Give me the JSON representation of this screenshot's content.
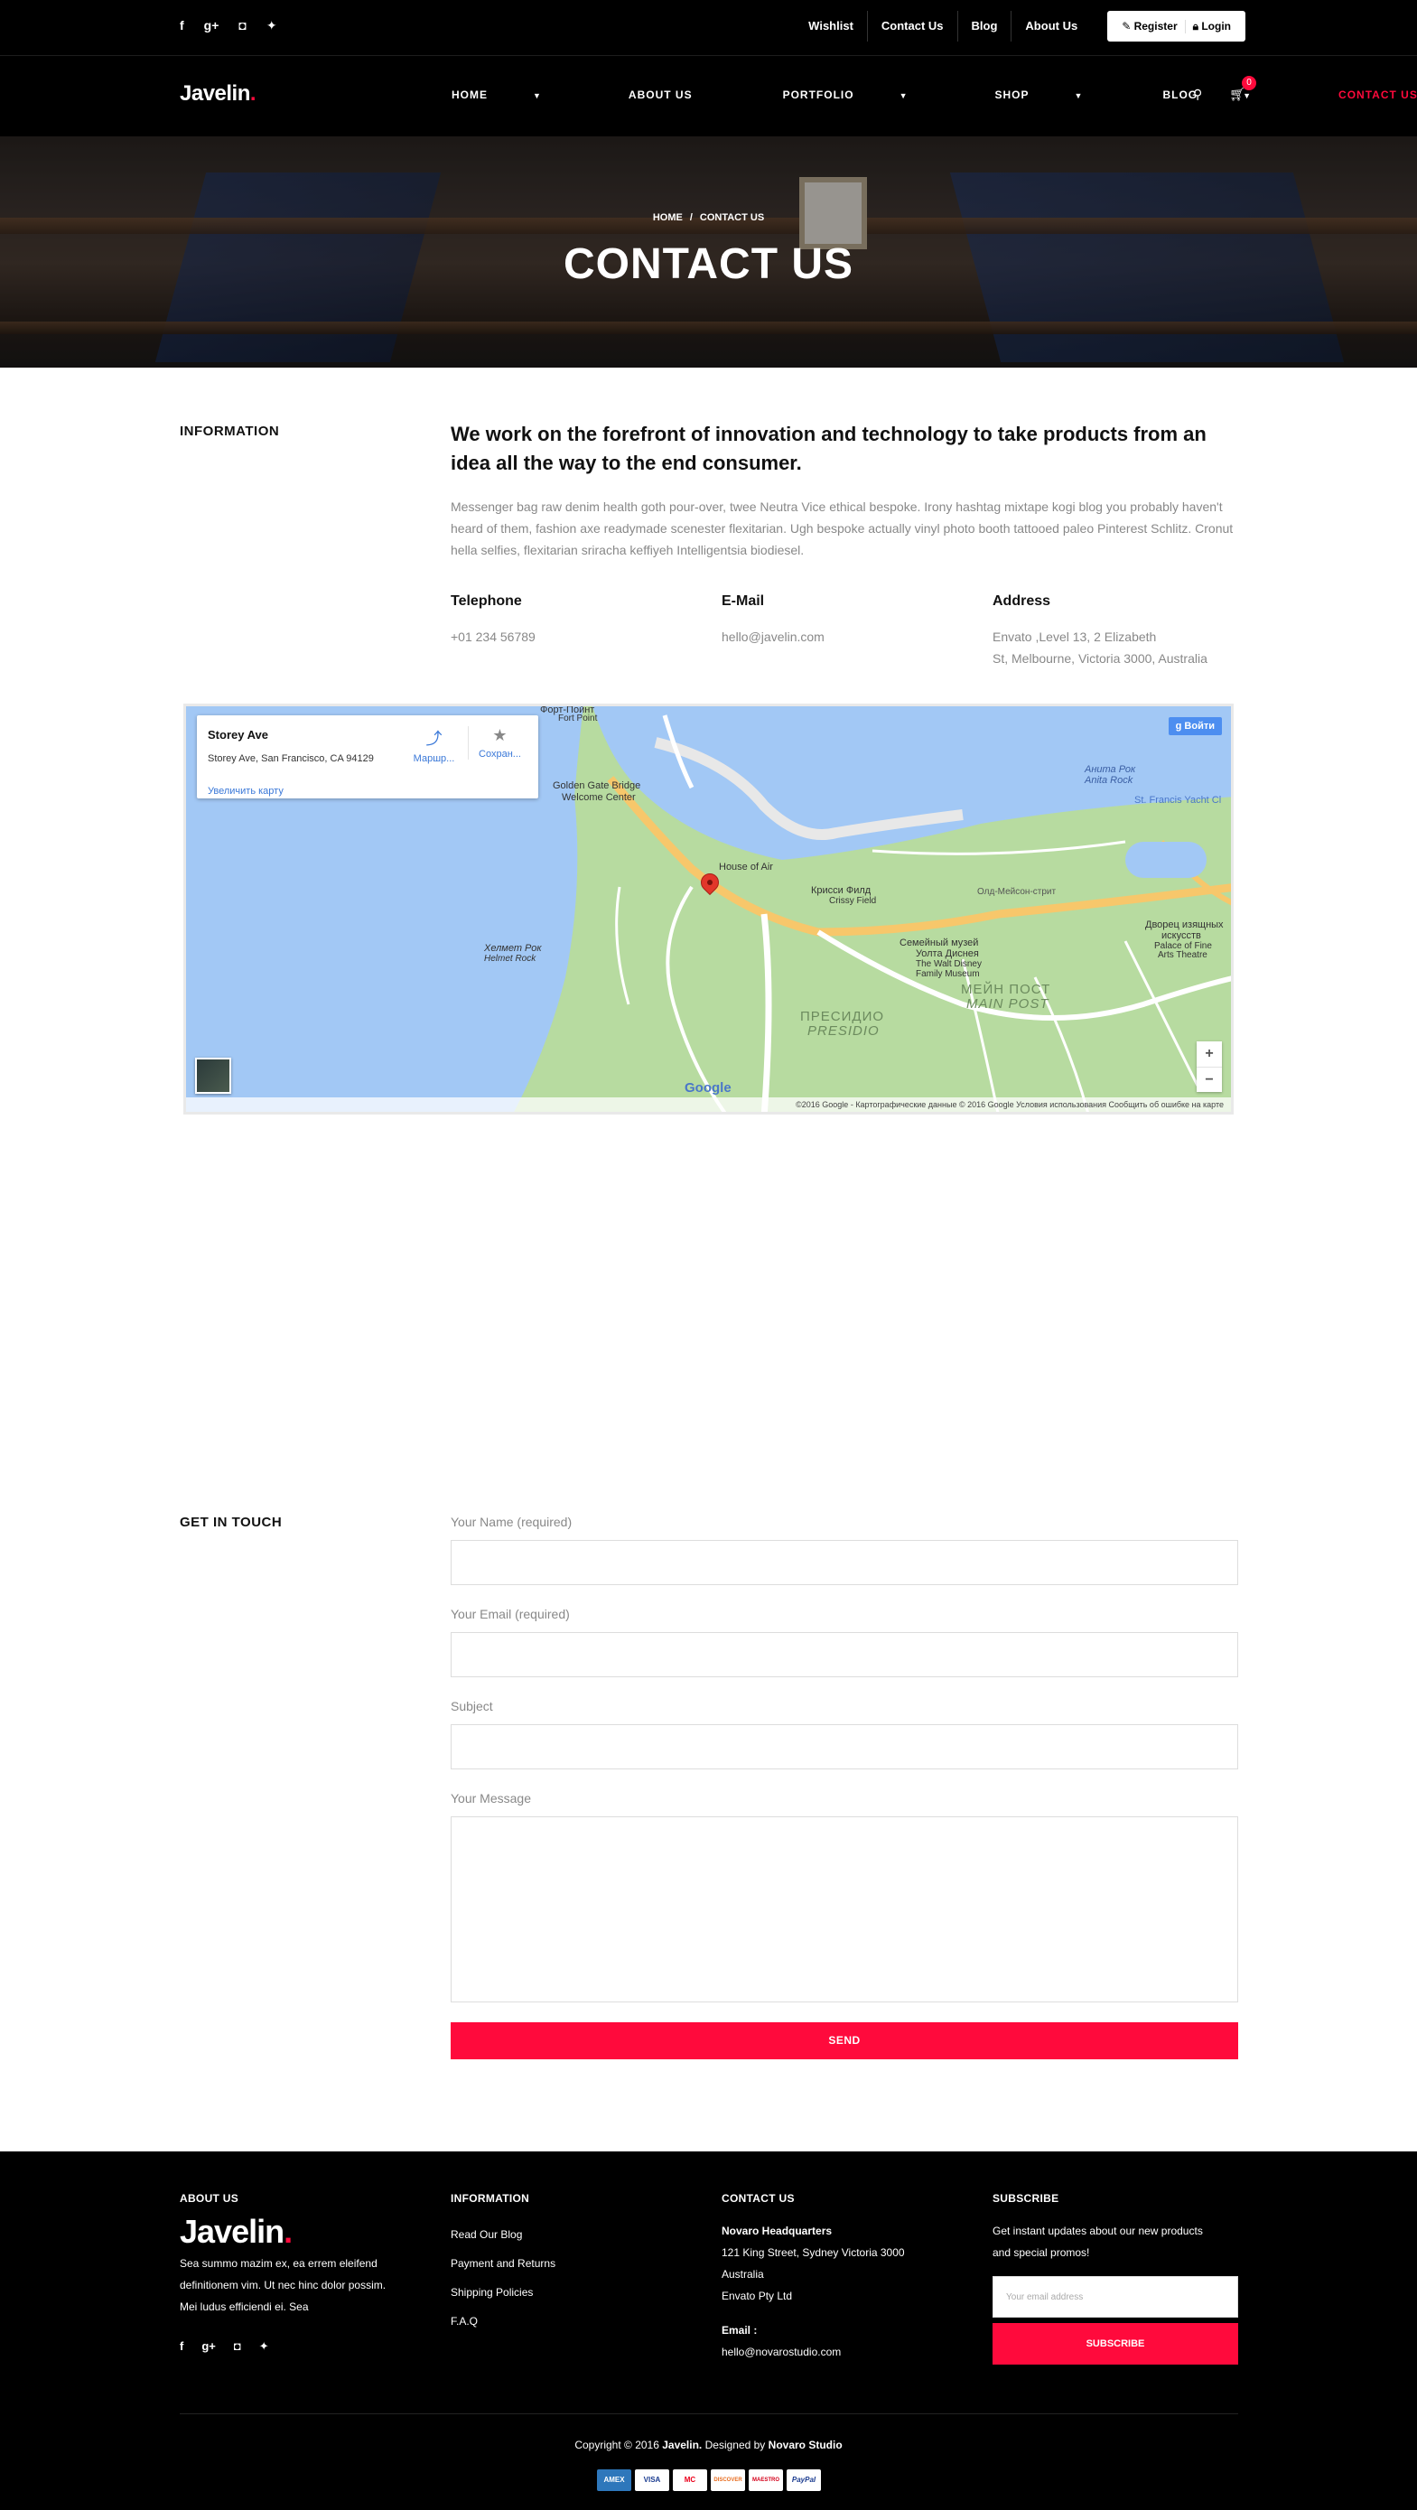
{
  "topbar": {
    "social_icons": [
      "facebook-icon",
      "google-plus-icon",
      "instagram-icon",
      "twitter-icon"
    ],
    "links": [
      "Wishlist",
      "Contact Us",
      "Blog",
      "About Us"
    ],
    "register": "Register",
    "login": "Login"
  },
  "nav": {
    "logo": "Javelin",
    "logo_dot": ".",
    "items": [
      "HOME",
      "ABOUT US",
      "PORTFOLIO",
      "SHOP",
      "BLOG",
      "CONTACT US"
    ],
    "cart_count": "0"
  },
  "hero": {
    "crumb_home": "HOME",
    "crumb_sep": "/",
    "crumb_current": "CONTACT US",
    "title": "CONTACT US"
  },
  "info": {
    "section_title": "INFORMATION",
    "lead": "We work on the forefront of innovation and technology to take products from an idea all the way to the end consumer.",
    "paragraph": "Messenger bag raw denim health goth pour-over, twee Neutra Vice ethical bespoke. Irony hashtag mixtape kogi blog you probably haven't heard of them, fashion axe readymade scenester flexitarian. Ugh bespoke actually vinyl photo booth tattooed paleo Pinterest Schlitz. Cronut hella selfies, flexitarian sriracha keffiyeh Intelligentsia biodiesel.",
    "telephone_h": "Telephone",
    "telephone": "+01 234 56789",
    "email_h": "E-Mail",
    "email": "hello@javelin.com",
    "address_h": "Address",
    "address_1": "Envato ,Level 13, 2 Elizabeth",
    "address_2": "St, Melbourne, Victoria 3000, Australia"
  },
  "map": {
    "place": "Storey Ave",
    "place_address": "Storey Ave, San Francisco, CA 94129",
    "enlarge": "Увеличить карту",
    "route": "Маршр...",
    "save": "Сохран...",
    "signin": "Войти",
    "labels": {
      "fort_point": "Форт-Пойнт",
      "fort_point_en": "Fort Point",
      "gg_bridge": "Golden Gate Bridge",
      "welcome": "Welcome Center",
      "house_of_air": "House of Air",
      "crissy": "Крисси Филд",
      "crissy_en": "Crissy Field",
      "helmet": "Хелмет Рок",
      "helmet_en": "Helmet Rock",
      "family_museum": "Семейный музей",
      "walt": "Уолта Диснея",
      "walt_en": "The Walt Disney",
      "family_en": "Family Museum",
      "presidio": "ПРЕСИДИО",
      "presidio_en": "PRESIDIO",
      "main_post": "МЕЙН ПОСТ",
      "main_post_en": "MAIN POST",
      "anita": "Анита Рок",
      "anita_en": "Anita Rock",
      "yacht": "St. Francis Yacht Cl",
      "palace": "Дворец изящных",
      "palace2": "искусств",
      "palace_en": "Palace of Fine",
      "palace_en2": "Arts Theatre",
      "mason": "Олд-Мейсон-стрит",
      "google": "Google"
    },
    "footer": "©2016 Google - Картографические данные © 2016 Google   Условия использования   Сообщить об ошибке на карте"
  },
  "form": {
    "section_title": "GET IN TOUCH",
    "name_label": "Your Name (required)",
    "email_label": "Your Email (required)",
    "subject_label": "Subject",
    "message_label": "Your Message",
    "send": "SEND"
  },
  "footer": {
    "about_h": "ABOUT US",
    "about_text_1": "Sea summo mazim ex, ea errem eleifend",
    "about_text_2": "definitionem vim. Ut nec hinc dolor possim.",
    "about_text_3": "Mei ludus efficiendi ei. Sea",
    "info_h": "INFORMATION",
    "info_links": [
      "Read Our Blog",
      "Payment and Returns",
      "Shipping Policies",
      "F.A.Q"
    ],
    "contact_h": "CONTACT US",
    "hq": "Novaro Headquarters",
    "addr_1": "121 King Street, Sydney Victoria 3000",
    "addr_2": "Australia",
    "addr_3": "Envato Pty Ltd",
    "email_h": "Email :",
    "email": "hello@novarostudio.com",
    "subscribe_h": "SUBSCRIBE",
    "subscribe_text_1": "Get instant updates about our new products",
    "subscribe_text_2": "and special promos!",
    "email_placeholder": "Your email address",
    "subscribe_btn": "SUBSCRIBE",
    "copy_pre": "Copyright © 2016 ",
    "copy_brand": "Javelin.",
    "copy_mid": " Designed by ",
    "copy_studio": "Novaro Studio",
    "payments": [
      "AMEX",
      "VISA",
      "MC",
      "DISCOVER",
      "MAESTRO",
      "PayPal"
    ]
  },
  "colors": {
    "accent": "#ff0a3c",
    "dark": "#000000"
  }
}
